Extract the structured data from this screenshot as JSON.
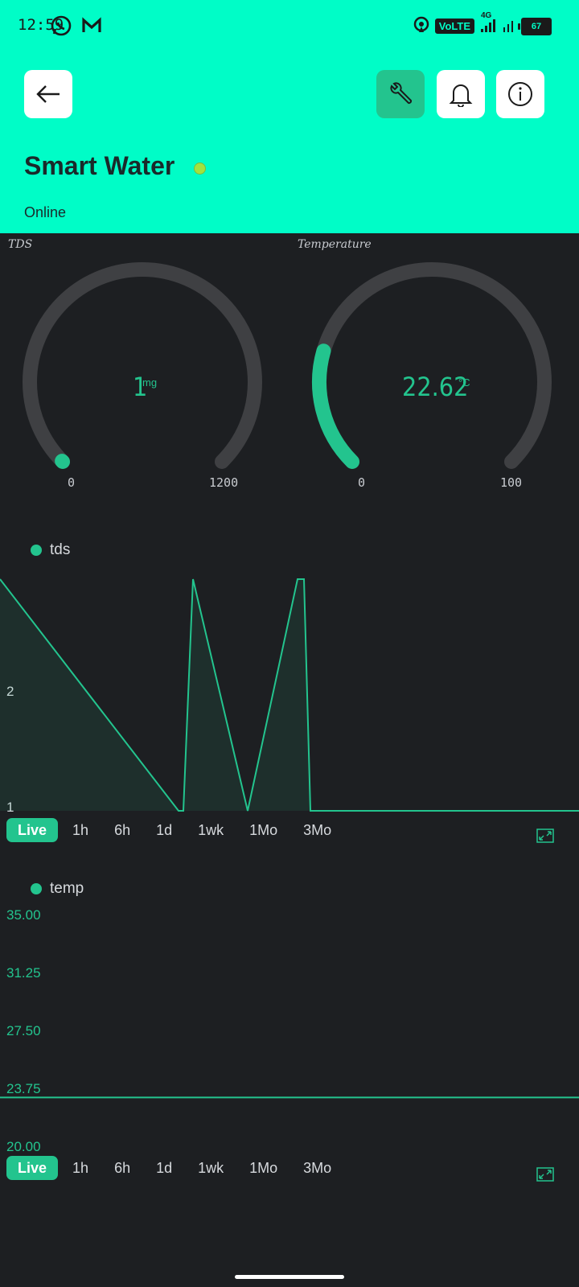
{
  "status_bar": {
    "time": "12:59",
    "network": "VoLTE",
    "signal_type": "4G",
    "battery": "67",
    "icons": [
      "whatsapp-icon",
      "gmail-icon",
      "hotspot-icon",
      "signal-icon",
      "battery-icon"
    ]
  },
  "header": {
    "title": "Smart Water",
    "status": "Online",
    "status_color": "#a2e23f",
    "bg_color": "#00fdc7",
    "buttons": [
      "back-arrow-icon",
      "wrench-icon",
      "bell-icon",
      "info-icon"
    ]
  },
  "gauges": [
    {
      "label": "TDS",
      "value": "1",
      "unit": "mg",
      "min": "0",
      "max": "1200",
      "level": 0.001
    },
    {
      "label": "Temperature",
      "value": "22.62",
      "unit": "°C",
      "min": "0",
      "max": "100",
      "level": 0.2262
    }
  ],
  "accent_color": "#23c48e",
  "charts": {
    "tds": {
      "legend": "tds",
      "ranges": [
        "Live",
        "1h",
        "6h",
        "1d",
        "1wk",
        "1Mo",
        "3Mo"
      ],
      "selected_range": "Live"
    },
    "temp": {
      "legend": "temp",
      "ranges": [
        "Live",
        "1h",
        "6h",
        "1d",
        "1wk",
        "1Mo",
        "3Mo"
      ],
      "selected_range": "Live"
    }
  },
  "chart_data": [
    {
      "type": "area",
      "series": [
        {
          "name": "tds",
          "values": [
            3,
            1,
            1,
            3,
            1,
            3,
            3,
            1,
            1
          ]
        }
      ],
      "x": [
        0,
        1,
        2,
        3,
        4,
        5,
        6,
        7,
        8
      ],
      "yticks": [
        "2",
        "1"
      ],
      "ylim": [
        1,
        3
      ],
      "grid": false
    },
    {
      "type": "line",
      "series": [
        {
          "name": "temp",
          "values": [
            22.62,
            22.62
          ]
        }
      ],
      "x": [
        0,
        1
      ],
      "yticks": [
        "35.00",
        "31.25",
        "27.50",
        "23.75",
        "20.00"
      ],
      "ylim": [
        20,
        35
      ],
      "grid": false
    }
  ]
}
